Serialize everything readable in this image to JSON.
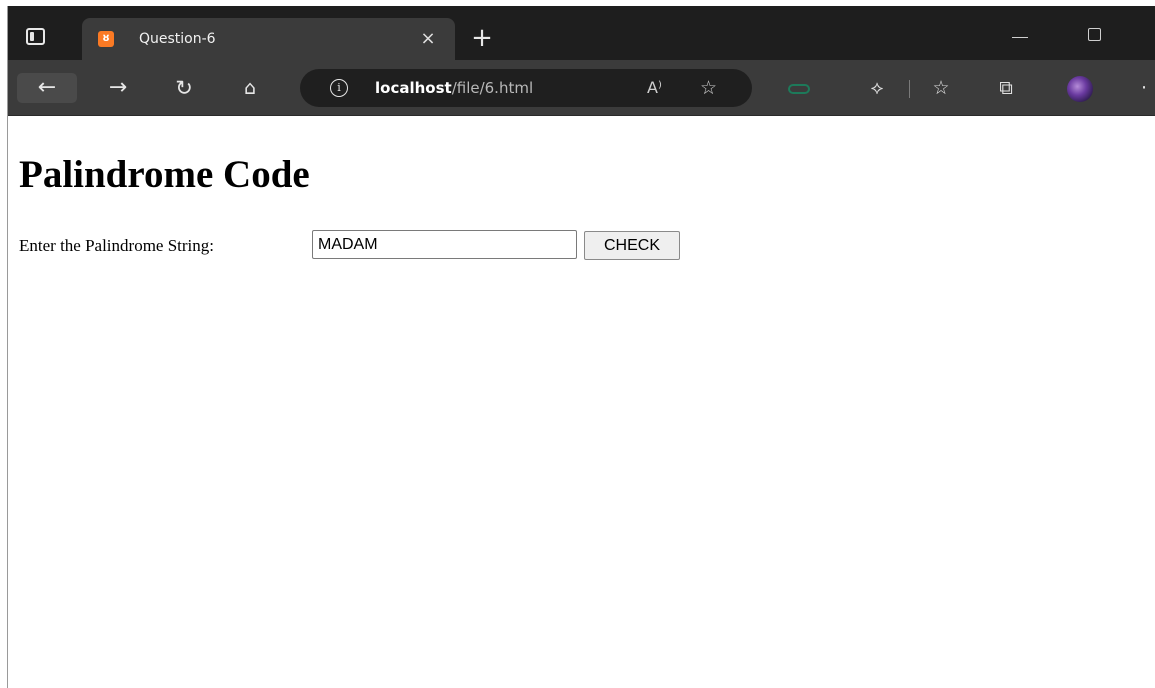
{
  "browser": {
    "tab": {
      "favicon_glyph": "ȣ",
      "title": "Question-6",
      "close_glyph": "×"
    },
    "new_tab_glyph": "+",
    "address_bar": {
      "url_host": "localhost",
      "url_path": "/file/6.html",
      "info_glyph": "i"
    },
    "toolbar_glyphs": {
      "back": "←",
      "forward": "→",
      "reload": "↻",
      "home": "⌂",
      "read_aloud": "A⁾",
      "add_favorite": "☆",
      "extensions": "⟡",
      "favorites": "☆",
      "collections": "⧉",
      "more": "·"
    },
    "icons": {
      "tab_actions": "tab-actions-icon",
      "favicon": "xampp-favicon-icon",
      "profile": "profile-avatar-icon",
      "extension_green": "green-extension-icon"
    }
  },
  "page": {
    "title": "Palindrome Code",
    "form": {
      "label": "Enter the Palindrome String:",
      "input_value": "MADAM",
      "button_label": "CHECK"
    }
  }
}
